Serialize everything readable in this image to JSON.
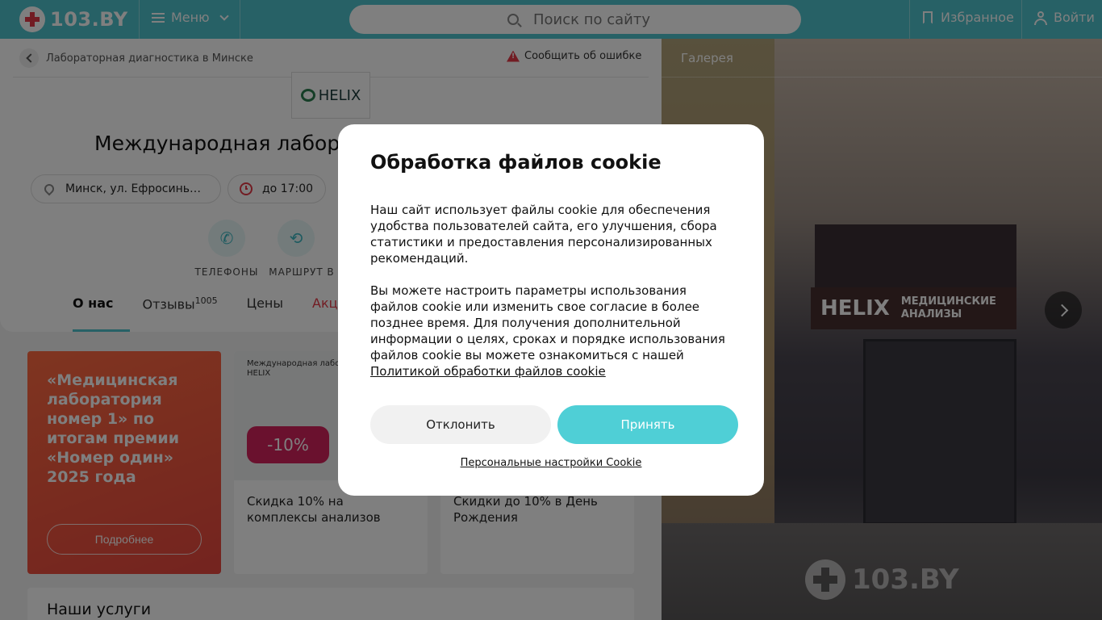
{
  "header": {
    "logo_text": "103.BY",
    "menu_label": "Меню",
    "search_placeholder": "Поиск по сайту",
    "favorites_label": "Избранное",
    "login_label": "Войти"
  },
  "breadcrumb": {
    "label": "Лабораторная диагностика в Минске"
  },
  "report_error_label": "Сообщить об ошибке",
  "org": {
    "logo_text": "HELIX",
    "title": "Международная лабора",
    "address": "Минск, ул. Ефросинь…",
    "hours": "до 17:00"
  },
  "actions": [
    {
      "label": "ТЕЛЕФОНЫ",
      "icon": "phone-icon"
    },
    {
      "label": "МАРШРУТ",
      "icon": "route-icon"
    },
    {
      "label": "В",
      "icon": ""
    }
  ],
  "tabs": [
    {
      "label": "О нас",
      "count": ""
    },
    {
      "label": "Отзывы",
      "count": "1005"
    },
    {
      "label": "Цены",
      "count": ""
    },
    {
      "label": "Акции и",
      "count": ""
    }
  ],
  "promos": {
    "award": {
      "text": "«Медицинская лаборатория номер 1» по итогам премии «Номер один» 2025 года",
      "button": "Подробнее"
    },
    "cards": [
      {
        "caption": "Международная лаборат HELIX",
        "badge": "-10%",
        "text": "Скидка 10% на комплексы анализов"
      },
      {
        "caption": "",
        "badge": "",
        "text": "Скидки до 10% в День Рождения"
      }
    ]
  },
  "services_title": "Наши услуги",
  "gallery": {
    "title": "Галерея",
    "sign_brand": "HELIX",
    "sign_text": "МЕДИЦИНСКИЕ АНАЛИЗЫ",
    "watermark": "103.BY"
  },
  "cookie_modal": {
    "title": "Обработка файлов cookie",
    "paragraph1": "Наш сайт использует файлы cookie для обеспечения удобства пользователей сайта, его улучшения, сбора статистики и предоставления персонализированных рекомендаций.",
    "paragraph2": "Вы можете настроить параметры использования файлов cookie или изменить свое согласие в более позднее время. Для получения дополнительной информации о целях, сроках и порядке использования файлов cookie вы можете ознакомиться с нашей ",
    "policy_link": "Политикой обработки файлов cookie",
    "decline": "Отклонить",
    "accept": "Принять",
    "settings_link": "Персональные настройки Cookie"
  },
  "colors": {
    "brand": "#4fc3cc",
    "accent_red": "#e53946",
    "accept_button": "#4fcfd6"
  }
}
